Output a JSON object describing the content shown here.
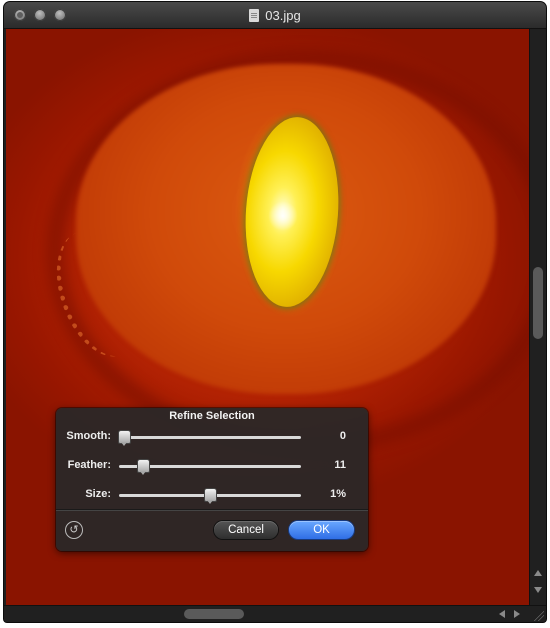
{
  "window": {
    "title": "03.jpg"
  },
  "dialog": {
    "title": "Refine Selection",
    "rows": [
      {
        "label": "Smooth:",
        "value": "0",
        "level": 0.0
      },
      {
        "label": "Feather:",
        "value": "11",
        "level": 0.11
      },
      {
        "label": "Size:",
        "value": "1%",
        "level": 0.5
      }
    ],
    "reset_icon": "↺",
    "cancel_label": "Cancel",
    "ok_label": "OK"
  },
  "colors": {
    "ok_button": "#3478f0",
    "selection_tint": "#b01e00",
    "selected_region": "#f5d800"
  }
}
